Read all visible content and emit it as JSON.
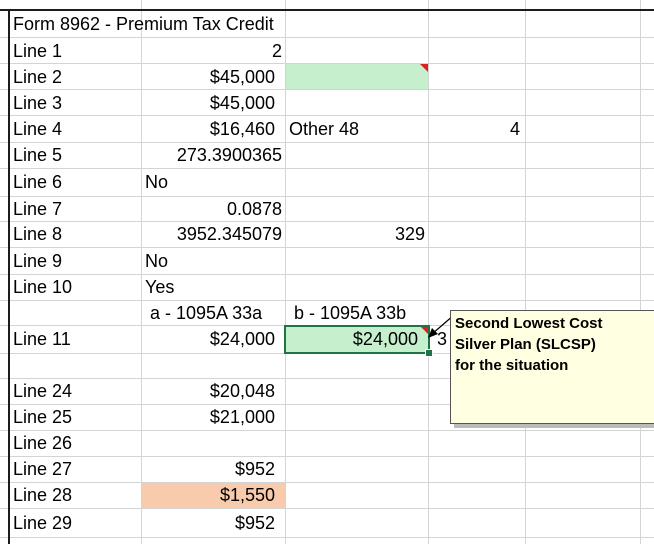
{
  "title": "Form 8962 - Premium Tax Credit",
  "rows": [
    {
      "label": "Line 1",
      "b": "2"
    },
    {
      "label": "Line 2",
      "b": "$45,000"
    },
    {
      "label": "Line 3",
      "b": "$45,000"
    },
    {
      "label": "Line 4",
      "b": "$16,460",
      "c": "Other 48",
      "d": "4"
    },
    {
      "label": "Line 5",
      "b": "273.3900365"
    },
    {
      "label": "Line 6",
      "b": "No"
    },
    {
      "label": "Line 7",
      "b": "0.0878"
    },
    {
      "label": "Line 8",
      "b": "3952.345079",
      "c": "329"
    },
    {
      "label": "Line 9",
      "b": "No"
    },
    {
      "label": "Line 10",
      "b": "Yes"
    },
    {
      "label": "",
      "b": "a - 1095A 33a",
      "c": "b - 1095A 33b"
    },
    {
      "label": "Line 11",
      "b": "$24,000",
      "c": "$24,000",
      "d": "3"
    },
    {
      "label": "Line 24",
      "b": "$20,048"
    },
    {
      "label": "Line 25",
      "b": "$21,000"
    },
    {
      "label": "Line 26",
      "b": ""
    },
    {
      "label": "Line 27",
      "b": "$952"
    },
    {
      "label": "Line 28",
      "b": "$1,550"
    },
    {
      "label": "Line 29",
      "b": "$952"
    }
  ],
  "comment": {
    "line1": "Second Lowest Cost",
    "line2": "Silver Plan (SLCSP)",
    "line3": "for the situation"
  },
  "colors": {
    "green_fill": "#c6efce",
    "orange_fill": "#f8cbad",
    "selection": "#217346"
  }
}
